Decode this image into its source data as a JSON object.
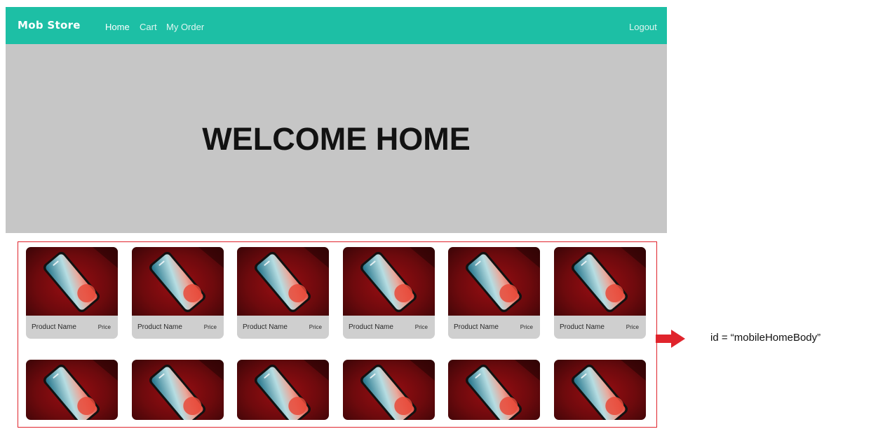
{
  "navbar": {
    "brand": "Mob Store",
    "links": [
      "Home",
      "Cart",
      "My Order"
    ],
    "logout": "Logout",
    "color": "#1dbfa5"
  },
  "hero": {
    "title": "WELCOME HOME",
    "background": "#c6c6c6"
  },
  "products": [
    {
      "name": "Product Name",
      "price": "Price"
    },
    {
      "name": "Product Name",
      "price": "Price"
    },
    {
      "name": "Product Name",
      "price": "Price"
    },
    {
      "name": "Product Name",
      "price": "Price"
    },
    {
      "name": "Product Name",
      "price": "Price"
    },
    {
      "name": "Product Name",
      "price": "Price"
    }
  ],
  "annotation": {
    "text": "id = “mobileHomeBody”",
    "color": "#e0242c"
  }
}
